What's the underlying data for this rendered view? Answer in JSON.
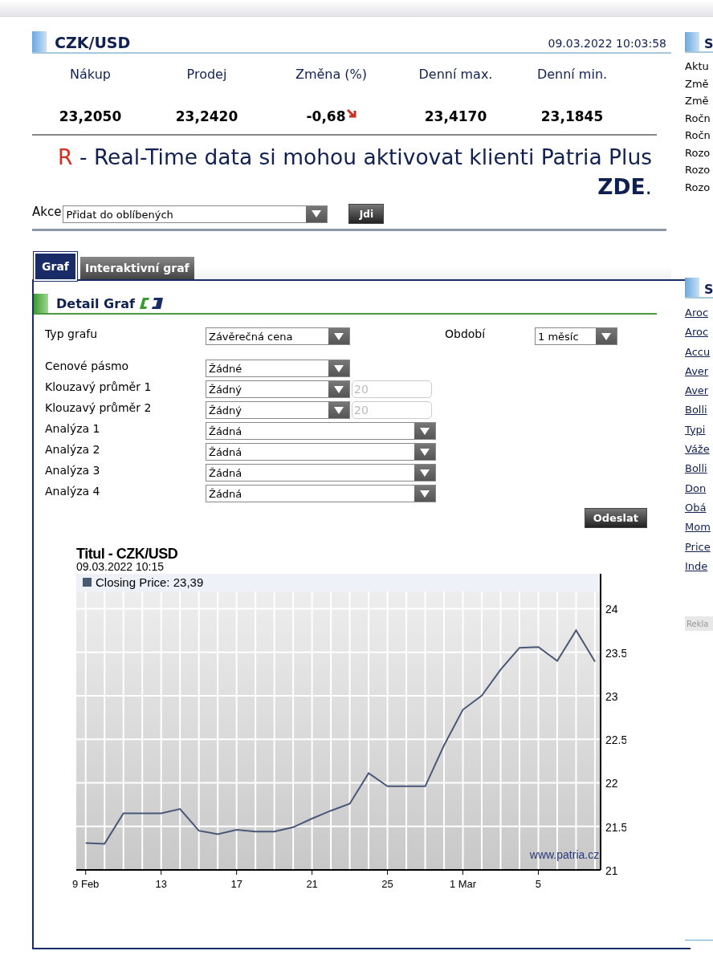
{
  "quote": {
    "title": "CZK/USD",
    "timestamp": "09.03.2022 10:03:58",
    "columns": [
      "Nákup",
      "Prodej",
      "Změna (%)",
      "Denní max.",
      "Denní min."
    ],
    "values": [
      "23,2050",
      "23,2420",
      "-0,68",
      "23,4170",
      "23,1845"
    ],
    "change_down": true
  },
  "notice": {
    "marker": "R",
    "text": "- Real-Time data si mohou aktivovat klienti Patria Plus",
    "link": "ZDE",
    "tail": "."
  },
  "action": {
    "label": "Akce",
    "select": "Přidat do oblíbených",
    "button": "Jdi"
  },
  "tabs": [
    {
      "label": "Graf",
      "selected": true
    },
    {
      "label": "Interaktivní graf",
      "selected": false
    }
  ],
  "detail": {
    "title": "Detail Graf",
    "period": {
      "label": "Období",
      "value": "1 měsíc"
    },
    "submit": "Odeslat",
    "fields": [
      {
        "label": "Typ grafu",
        "value": "Závěrečná cena",
        "kind": "select"
      },
      {
        "label": "Cenové pásmo",
        "value": "Žádné",
        "kind": "select"
      },
      {
        "label": "Klouzavý průměr 1",
        "value": "Žádný",
        "kind": "select_input",
        "input": "20",
        "disabled": true
      },
      {
        "label": "Klouzavý průměr 2",
        "value": "Žádný",
        "kind": "select_input",
        "input": "20",
        "disabled": true
      },
      {
        "label": "Analýza 1",
        "value": "Žádná",
        "kind": "wide"
      },
      {
        "label": "Analýza 2",
        "value": "Žádná",
        "kind": "wide"
      },
      {
        "label": "Analýza 3",
        "value": "Žádná",
        "kind": "wide"
      },
      {
        "label": "Analýza 4",
        "value": "Žádná",
        "kind": "wide"
      }
    ]
  },
  "chart": {
    "title": "Titul - CZK/USD",
    "timestamp": "09.03.2022 10:15",
    "legend_suffix": ": 23,39",
    "credit": "www.patria.cz",
    "chart_data": {
      "type": "line",
      "categories": [
        "9 Feb",
        null,
        null,
        null,
        "13",
        null,
        null,
        null,
        "17",
        null,
        null,
        null,
        "21",
        null,
        null,
        null,
        "25",
        null,
        null,
        null,
        "1 Mar",
        null,
        null,
        null,
        "5",
        null,
        null,
        null
      ],
      "series": [
        {
          "name": "Closing Price",
          "color": "#4a5878",
          "values": [
            21.31,
            21.3,
            21.65,
            21.65,
            21.65,
            21.7,
            21.45,
            21.41,
            21.46,
            21.44,
            21.44,
            21.49,
            21.59,
            21.68,
            21.76,
            22.11,
            21.96,
            21.96,
            21.96,
            22.43,
            22.84,
            23.0,
            23.3,
            23.55,
            23.56,
            23.4,
            23.75,
            23.39
          ]
        }
      ],
      "ylim": [
        21,
        24.4
      ],
      "grid": true,
      "yticks": [
        21,
        21.5,
        22,
        22.5,
        23,
        23.5,
        24
      ]
    }
  },
  "side": {
    "sections": [
      {
        "title": "S",
        "kind": "text",
        "items": [
          "Aktu",
          "Změ",
          "Změ",
          "Ročn",
          "Ročn",
          "Rozo",
          "Rozo",
          "Rozo"
        ]
      },
      {
        "title": "S",
        "kind": "links",
        "items": [
          "Aroc",
          "Aroc",
          "Accu",
          "Aver",
          "Aver",
          "Bolli",
          "Typi",
          "Váže",
          "Bolli",
          "Don",
          "Obá",
          "Mom",
          "Price",
          "Inde"
        ]
      }
    ],
    "ad_label": "Rekla"
  }
}
